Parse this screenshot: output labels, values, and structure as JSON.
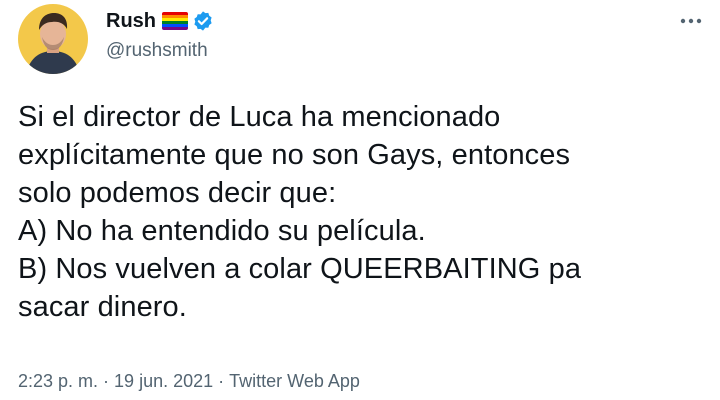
{
  "tweet": {
    "author": {
      "display_name": "Rush",
      "handle": "@rushsmith",
      "avatar_icon": "profile-photo",
      "flag_icon": "rainbow-flag-emoji",
      "verified_icon": "verified-badge-icon",
      "verified_color": "#1d9bf0"
    },
    "more_icon": "more-options-icon",
    "text": "Si el director de Luca ha mencionado\nexplícitamente que no son Gays, entonces\nsolo podemos decir que:\nA) No ha entendido su película.\nB) Nos vuelven a colar QUEERBAITING pa\nsacar dinero.",
    "time": "2:23 p. m.",
    "date": "19 jun. 2021",
    "source": "Twitter Web App",
    "separator": "·"
  }
}
